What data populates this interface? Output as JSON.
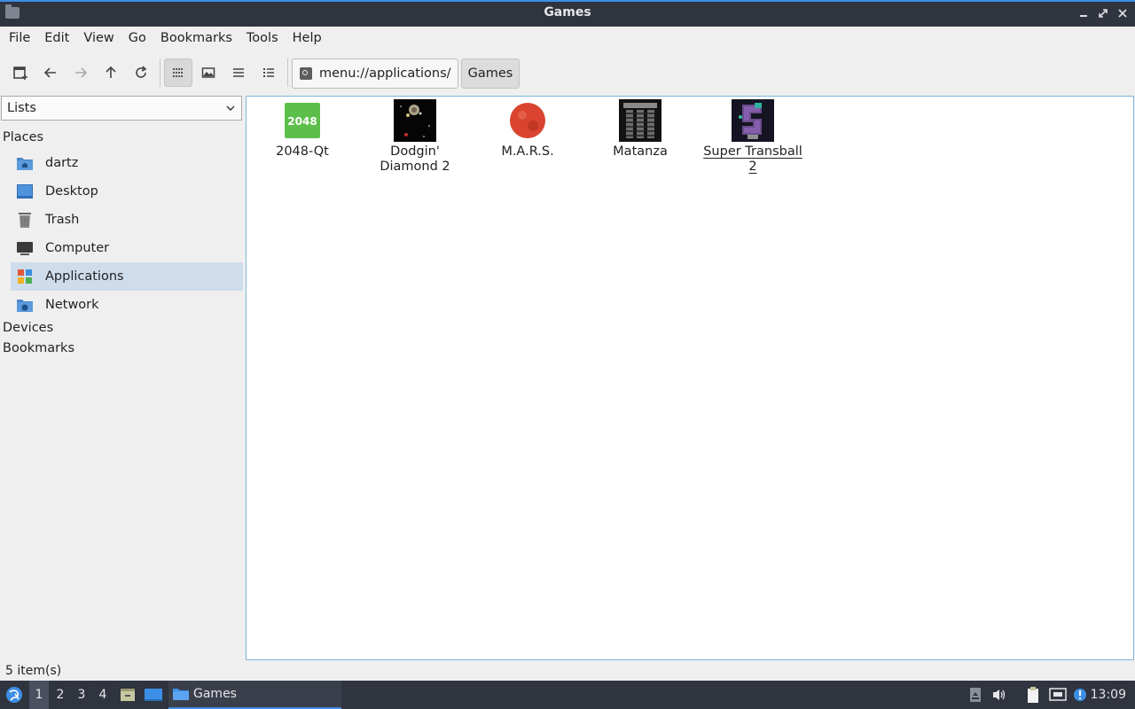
{
  "window": {
    "title": "Games"
  },
  "menubar": {
    "items": [
      "File",
      "Edit",
      "View",
      "Go",
      "Bookmarks",
      "Tools",
      "Help"
    ]
  },
  "toolbar": {
    "location": "menu://applications/",
    "breadcrumb": "Games"
  },
  "sidebar": {
    "mode": "Lists",
    "sections": {
      "places": "Places",
      "devices": "Devices",
      "bookmarks": "Bookmarks"
    },
    "places": [
      {
        "label": "dartz",
        "icon": "home-folder-icon"
      },
      {
        "label": "Desktop",
        "icon": "desktop-icon"
      },
      {
        "label": "Trash",
        "icon": "trash-icon"
      },
      {
        "label": "Computer",
        "icon": "computer-icon"
      },
      {
        "label": "Applications",
        "icon": "applications-icon",
        "selected": true
      },
      {
        "label": "Network",
        "icon": "network-icon"
      }
    ]
  },
  "files": [
    {
      "label": "2048-Qt",
      "icon_text": "2048"
    },
    {
      "label": "Dodgin' Diamond 2"
    },
    {
      "label": "M.A.R.S."
    },
    {
      "label": "Matanza"
    },
    {
      "label": "Super Transball 2"
    }
  ],
  "status": {
    "text": "5 item(s)"
  },
  "taskbar": {
    "desktops": [
      "1",
      "2",
      "3",
      "4"
    ],
    "active_desktop": "1",
    "task": "Games",
    "clock": "13:09"
  },
  "colors": {
    "accent": "#3d8ee6",
    "titlebar": "#2f343f",
    "selection": "#cfdcec"
  }
}
